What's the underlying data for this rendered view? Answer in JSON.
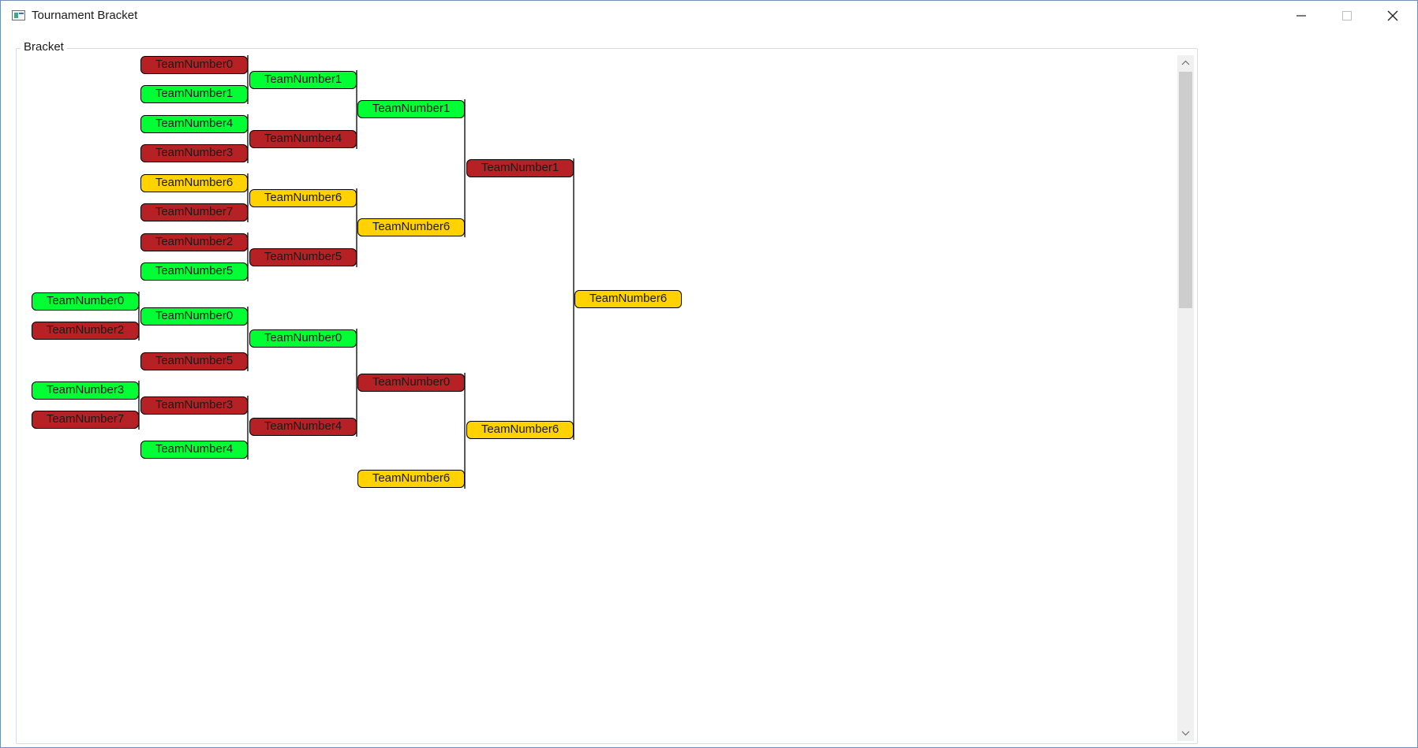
{
  "window": {
    "title": "Tournament Bracket",
    "controls": {
      "minimize": "minimize-icon",
      "maximize": "maximize-icon",
      "close": "close-icon"
    }
  },
  "group": {
    "label": "Bracket"
  },
  "colors": {
    "win": "#00ff33",
    "loss": "#b52124",
    "pending": "#ffd200"
  },
  "bracket": {
    "round_a": [
      {
        "team": "TeamNumber0",
        "status": "win"
      },
      {
        "team": "TeamNumber2",
        "status": "loss"
      },
      {
        "team": "TeamNumber3",
        "status": "win"
      },
      {
        "team": "TeamNumber7",
        "status": "loss"
      }
    ],
    "round_b": [
      {
        "team": "TeamNumber0",
        "status": "loss"
      },
      {
        "team": "TeamNumber1",
        "status": "win"
      },
      {
        "team": "TeamNumber4",
        "status": "win"
      },
      {
        "team": "TeamNumber3",
        "status": "loss"
      },
      {
        "team": "TeamNumber6",
        "status": "pending"
      },
      {
        "team": "TeamNumber7",
        "status": "loss"
      },
      {
        "team": "TeamNumber2",
        "status": "loss"
      },
      {
        "team": "TeamNumber5",
        "status": "win"
      },
      {
        "team": "TeamNumber0",
        "status": "win"
      },
      {
        "team": "TeamNumber5",
        "status": "loss"
      },
      {
        "team": "TeamNumber3",
        "status": "loss"
      },
      {
        "team": "TeamNumber4",
        "status": "win"
      }
    ],
    "round_c": [
      {
        "team": "TeamNumber1",
        "status": "win"
      },
      {
        "team": "TeamNumber4",
        "status": "loss"
      },
      {
        "team": "TeamNumber6",
        "status": "pending"
      },
      {
        "team": "TeamNumber5",
        "status": "loss"
      },
      {
        "team": "TeamNumber0",
        "status": "win"
      },
      {
        "team": "TeamNumber4",
        "status": "loss"
      }
    ],
    "round_d": [
      {
        "team": "TeamNumber1",
        "status": "win"
      },
      {
        "team": "TeamNumber6",
        "status": "pending"
      },
      {
        "team": "TeamNumber0",
        "status": "loss"
      },
      {
        "team": "TeamNumber6",
        "status": "pending"
      }
    ],
    "round_e": [
      {
        "team": "TeamNumber1",
        "status": "loss"
      },
      {
        "team": "TeamNumber6",
        "status": "pending"
      }
    ],
    "round_f": [
      {
        "team": "TeamNumber6",
        "status": "pending"
      }
    ]
  }
}
